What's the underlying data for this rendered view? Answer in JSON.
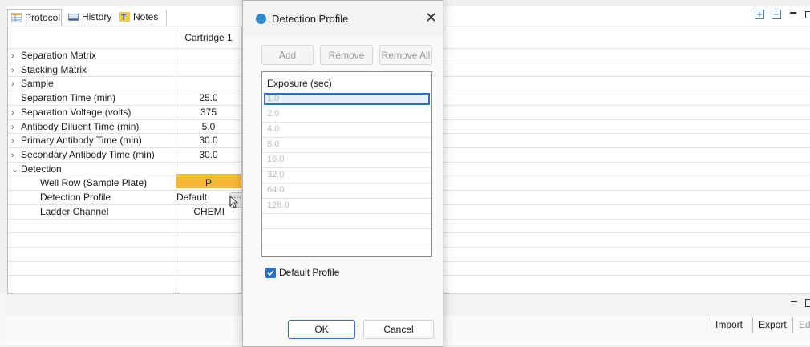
{
  "tabs": [
    {
      "label": "Protocol",
      "icon": "protocol-grid-icon",
      "active": true
    },
    {
      "label": "History",
      "icon": "history-icon",
      "active": false
    },
    {
      "label": "Notes",
      "icon": "notes-icon",
      "active": false
    }
  ],
  "grid": {
    "column_header": "Cartridge 1",
    "rows": [
      {
        "label": "Separation Matrix",
        "expandable": true,
        "value": ""
      },
      {
        "label": "Stacking Matrix",
        "expandable": true,
        "value": ""
      },
      {
        "label": "Sample",
        "expandable": true,
        "value": ""
      },
      {
        "label": "Separation Time (min)",
        "expandable": false,
        "value": "25.0"
      },
      {
        "label": "Separation Voltage (volts)",
        "expandable": false,
        "value": "375"
      },
      {
        "label": "Antibody Diluent Time (min)",
        "expandable": true,
        "value": "5.0"
      },
      {
        "label": "Primary Antibody Time (min)",
        "expandable": true,
        "value": "30.0"
      },
      {
        "label": "Secondary Antibody Time (min)",
        "expandable": true,
        "value": "30.0"
      },
      {
        "label": "Detection",
        "expandable": true,
        "expanded": true,
        "value": ""
      },
      {
        "label": "Well Row (Sample Plate)",
        "child": true,
        "value": "P"
      },
      {
        "label": "Detection Profile",
        "child": true,
        "value": "Default"
      },
      {
        "label": "Ladder Channel",
        "child": true,
        "value": "CHEMI"
      }
    ],
    "highlight_color": "#f7b935"
  },
  "lower_toolbar": {
    "import_label": "Import",
    "export_label": "Export",
    "edit_label": "Ed"
  },
  "dialog": {
    "title": "Detection Profile",
    "add_label": "Add",
    "remove_label": "Remove",
    "remove_all_label": "Remove All",
    "list_header": "Exposure (sec)",
    "exposures": [
      "1.0",
      "2.0",
      "4.0",
      "8.0",
      "16.0",
      "32.0",
      "64.0",
      "128.0"
    ],
    "default_profile_label": "Default Profile",
    "default_profile_checked": true,
    "ok_label": "OK",
    "cancel_label": "Cancel",
    "accent_color": "#2a6fc7"
  }
}
